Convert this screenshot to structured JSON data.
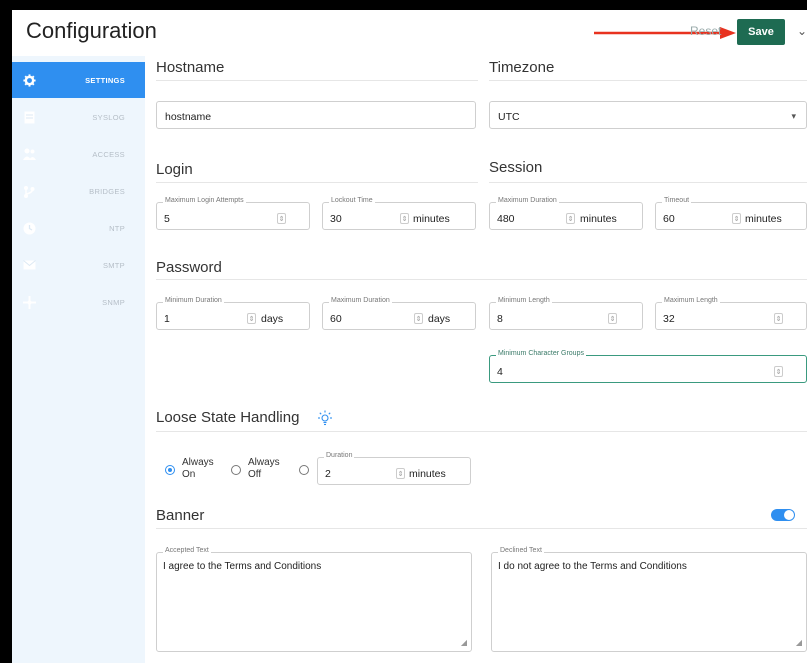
{
  "header": {
    "title": "Configuration",
    "reset_label": "Reset",
    "save_label": "Save",
    "chevron": "⌄"
  },
  "sidebar": {
    "items": [
      {
        "label": "SETTINGS",
        "icon": "gear-icon",
        "active": true
      },
      {
        "label": "SYSLOG",
        "icon": "document-icon",
        "active": false
      },
      {
        "label": "ACCESS",
        "icon": "users-icon",
        "active": false
      },
      {
        "label": "BRIDGES",
        "icon": "bridge-icon",
        "active": false
      },
      {
        "label": "NTP",
        "icon": "clock-icon",
        "active": false
      },
      {
        "label": "SMTP",
        "icon": "mail-icon",
        "active": false
      },
      {
        "label": "SNMP",
        "icon": "network-icon",
        "active": false
      }
    ]
  },
  "hostname": {
    "title": "Hostname",
    "value": "hostname"
  },
  "timezone": {
    "title": "Timezone",
    "value": "UTC",
    "arrow": "▾"
  },
  "login": {
    "title": "Login",
    "max_attempts_label": "Maximum Login Attempts",
    "max_attempts_value": "5",
    "lockout_label": "Lockout Time",
    "lockout_value": "30",
    "lockout_unit": "minutes"
  },
  "session": {
    "title": "Session",
    "max_duration_label": "Maximum Duration",
    "max_duration_value": "480",
    "max_duration_unit": "minutes",
    "timeout_label": "Timeout",
    "timeout_value": "60",
    "timeout_unit": "minutes"
  },
  "password": {
    "title": "Password",
    "min_duration_label": "Minimum Duration",
    "min_duration_value": "1",
    "min_duration_unit": "days",
    "max_duration_label": "Maximum Duration",
    "max_duration_value": "60",
    "max_duration_unit": "days",
    "min_length_label": "Minimum Length",
    "min_length_value": "8",
    "max_length_label": "Maximum Length",
    "max_length_value": "32",
    "min_groups_label": "Minimum Character Groups",
    "min_groups_value": "4"
  },
  "loose_state": {
    "title": "Loose State Handling",
    "icon": "lightbulb-icon",
    "option_always": "Always",
    "option_on": "On",
    "option_off": "Off",
    "selected": "always-on",
    "duration_label": "Duration",
    "duration_value": "2",
    "duration_unit": "minutes"
  },
  "banner": {
    "title": "Banner",
    "enabled": true,
    "accepted_label": "Accepted Text",
    "accepted_value": "I agree to the Terms and Conditions",
    "declined_label": "Declined Text",
    "declined_value": "I do not agree to the Terms and Conditions"
  },
  "colors": {
    "accent": "#2f8ff0",
    "save_button": "#1e6b52",
    "sidebar_bg": "#eef6fd",
    "annotation_arrow": "#e8321f"
  }
}
